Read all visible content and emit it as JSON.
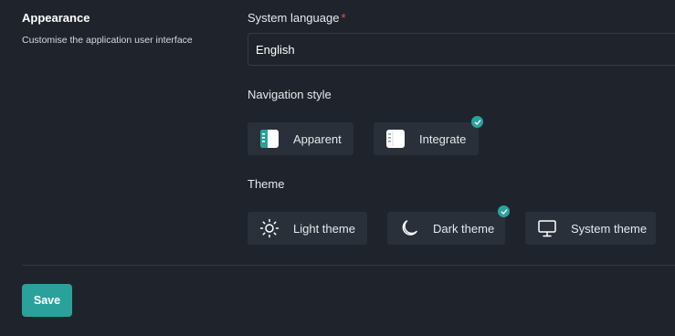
{
  "section": {
    "title": "Appearance",
    "description": "Customise the application user interface"
  },
  "language": {
    "label": "System language",
    "required_mark": "*",
    "value": "English"
  },
  "navigation": {
    "label": "Navigation style",
    "options": [
      {
        "label": "Apparent",
        "icon": "sidebar-apparent-icon",
        "selected": false
      },
      {
        "label": "Integrate",
        "icon": "sidebar-integrate-icon",
        "selected": true
      }
    ]
  },
  "theme": {
    "label": "Theme",
    "options": [
      {
        "label": "Light theme",
        "icon": "sun-icon",
        "selected": false
      },
      {
        "label": "Dark theme",
        "icon": "moon-icon",
        "selected": true
      },
      {
        "label": "System theme",
        "icon": "monitor-icon",
        "selected": false
      }
    ]
  },
  "actions": {
    "save_label": "Save"
  },
  "colors": {
    "accent": "#2aa19a",
    "background": "#1f242c",
    "card": "#2a3039",
    "required": "#e05757"
  }
}
